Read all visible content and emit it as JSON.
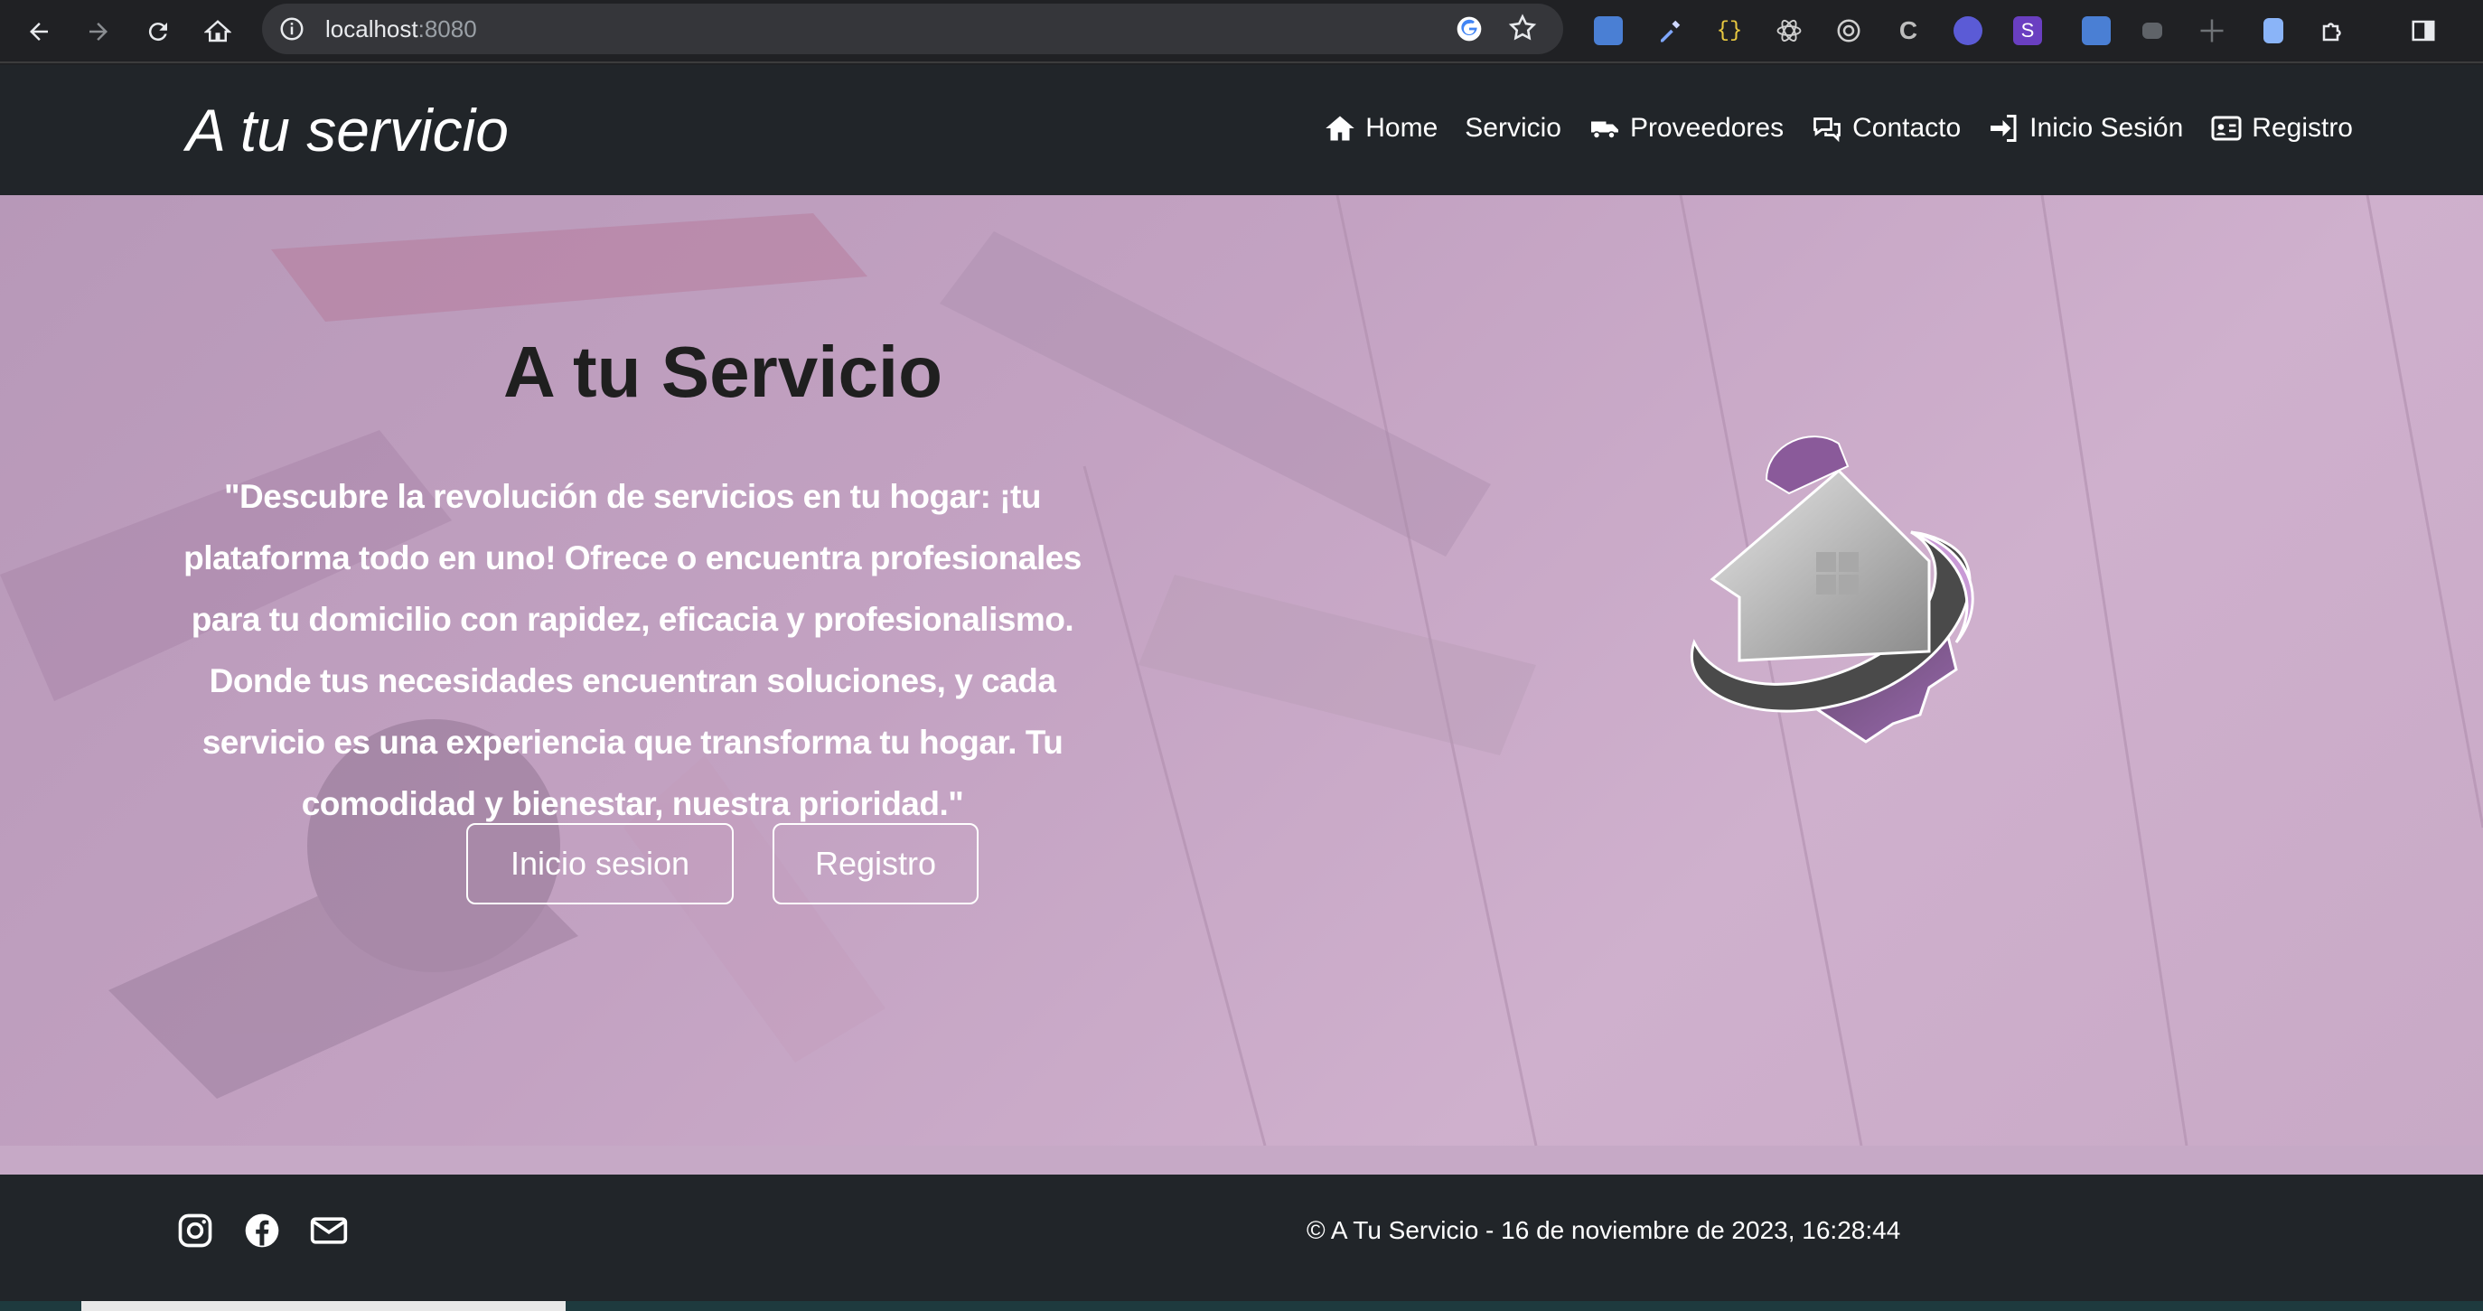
{
  "browser": {
    "url_host": "localhost",
    "url_port": ":8080"
  },
  "site": {
    "brand": "A tu servicio",
    "nav": [
      {
        "label": "Home",
        "icon": "home-icon"
      },
      {
        "label": "Servicio",
        "icon": ""
      },
      {
        "label": "Proveedores",
        "icon": "truck-icon"
      },
      {
        "label": "Contacto",
        "icon": "comments-icon"
      },
      {
        "label": "Inicio Sesión",
        "icon": "sign-in-icon"
      },
      {
        "label": "Registro",
        "icon": "id-card-icon"
      }
    ]
  },
  "hero": {
    "title": "A tu Servicio",
    "text": "\"Descubre la revolución de servicios en tu hogar: ¡tu plataforma todo en uno! Ofrece o encuentra profesionales para tu domicilio con rapidez, eficacia y profesionalismo. Donde tus necesidades encuentran soluciones, y cada servicio es una experiencia que transforma tu hogar. Tu comodidad y bienestar, nuestra prioridad.\"",
    "login_button": "Inicio sesion",
    "register_button": "Registro"
  },
  "footer": {
    "copyright": "© A Tu Servicio -  16 de noviembre de 2023, 16:28:44",
    "social_icons": [
      "instagram-icon",
      "facebook-icon",
      "envelope-icon"
    ]
  },
  "colors": {
    "navbar_bg": "#212529",
    "hero_overlay": "#c3a2c2",
    "chrome_bg": "#202124"
  }
}
